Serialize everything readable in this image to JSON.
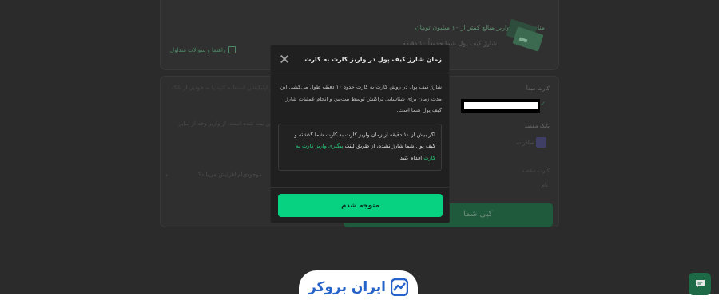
{
  "background": {
    "card_text_1": "مناسب برای واریز مبالغ کمتر از ۱۰ میلیون تومان",
    "card_text_2": "شارژ کیف پول شما حدوداً ۱۰ دقیقه",
    "faq_link": "راهنما و سوالات متداول",
    "paragraph_1": "اگر در واریز، توجه می‌شود از اپلیکیشن استفاده کنید یا به خودپرداز بانک مراجعه کنید.",
    "paragraph_2": "کارتی انجام دهید که در بیت‌پین ثبت شده است. از واریز وجه از سایر کارت‌ها خودداری فرمایید.",
    "origin_card_label": "کارت مبدأ",
    "dest_bank_label": "بانک مقصد",
    "dest_bank_name": "صادرات",
    "dest_card_label": "کارت مقصد",
    "dest_card_value": "نام",
    "question": "موجودی‌ام افزایش می‌یابد؟",
    "copy_button": "کپی شما"
  },
  "modal": {
    "title": "زمان شارژ کیف پول در واریز کارت به کارت",
    "description": "شارژ کیف پول در روش کارت به کارت حدود ۱۰ دقیقه طول می‌کشد. این مدت زمان برای شناسایی تراکنش توسط بیت‌پین و انجام عملیات شارژ کیف پول شما است.",
    "note_before": "اگر بیش از ۱۰ دقیقه از زمان واریز کارت به کارت شما گذشته و کیف پول شما شارژ نشده، از طریق لینک ",
    "note_link": "پیگیری واریز کارت به کارت",
    "note_after": " اقدام کنید.",
    "confirm_button": "متوجه شدم"
  },
  "footer": {
    "logo_text": "ایران بروکر"
  },
  "colors": {
    "accent": "#06d282",
    "link": "#26d07c",
    "logo_blue": "#2563c9"
  }
}
